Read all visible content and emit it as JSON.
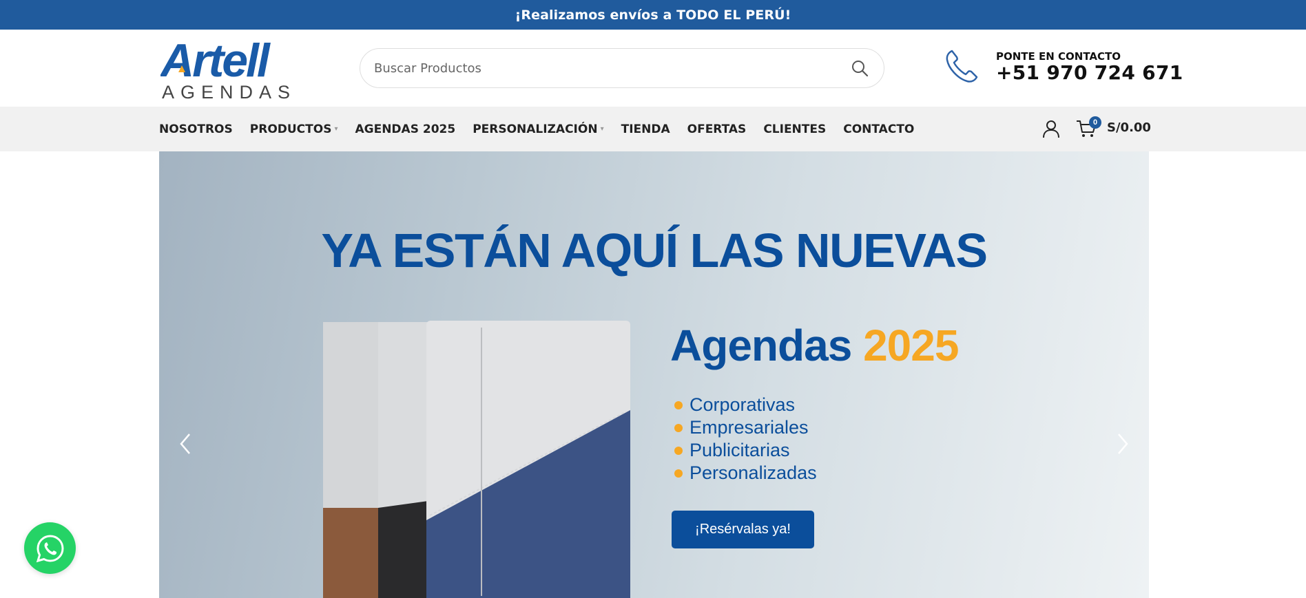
{
  "announcement": {
    "text": "¡Realizamos envíos a TODO EL PERÚ!"
  },
  "header": {
    "logo": {
      "brand": "Artell",
      "sub": "AGENDAS"
    },
    "search": {
      "placeholder": "Buscar Productos",
      "value": ""
    },
    "contact": {
      "label": "PONTE EN CONTACTO",
      "phone": "+51 970 724 671"
    }
  },
  "nav": {
    "items": [
      {
        "label": "NOSOTROS",
        "dropdown": false
      },
      {
        "label": "PRODUCTOS",
        "dropdown": true
      },
      {
        "label": "AGENDAS 2025",
        "dropdown": false
      },
      {
        "label": "PERSONALIZACIÓN",
        "dropdown": true
      },
      {
        "label": "TIENDA",
        "dropdown": false
      },
      {
        "label": "OFERTAS",
        "dropdown": false
      },
      {
        "label": "CLIENTES",
        "dropdown": false
      },
      {
        "label": "CONTACTO",
        "dropdown": false
      }
    ],
    "cart": {
      "count": "0",
      "total": "S/0.00"
    }
  },
  "hero": {
    "title": "YA ESTÁN AQUÍ LAS NUEVAS",
    "subtitle": "Agendas",
    "year": "2025",
    "list": [
      "Corporativas",
      "Empresariales",
      "Publicitarias",
      "Personalizadas"
    ],
    "button": "¡Resérvalas ya!"
  },
  "colors": {
    "primary": "#205b9d",
    "hero_blue": "#0b4e9b",
    "accent": "#f6a723",
    "whatsapp": "#25d366"
  },
  "icons": [
    "search-icon",
    "phone-icon",
    "user-icon",
    "cart-icon",
    "chevron-left-icon",
    "chevron-right-icon",
    "whatsapp-icon"
  ]
}
